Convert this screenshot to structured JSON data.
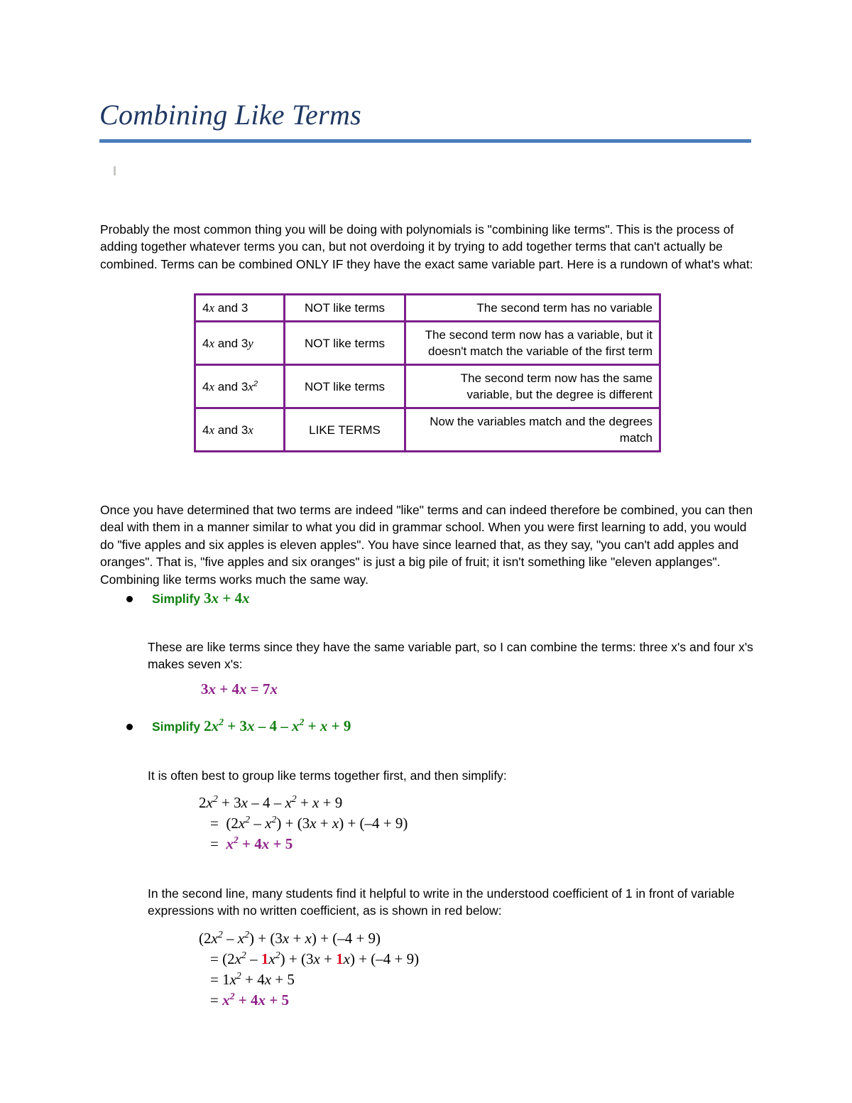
{
  "document": {
    "title": "Combining Like Terms",
    "title_color": "#1F3864",
    "rule_color": "#4A7EBB"
  },
  "intro": {
    "paragraph": "Probably the most common thing you will be doing with polynomials is \"combining like terms\". This is the process of adding together whatever terms you can, but not overdoing it by trying to add together terms that can't actually be combined. Terms can be combined ONLY IF they have the exact same variable part. Here is a rundown of what's what:"
  },
  "table": {
    "border_color": "#7D1F8C",
    "rows": [
      {
        "expr_prefix": "4",
        "expr_var": "x",
        "expr_mid": " and 3",
        "expr_second": "",
        "expr_second_exp": "",
        "expression_plain": "4x and 3",
        "verdict": "NOT like terms",
        "reason": "The second term has no variable"
      },
      {
        "expression_plain": "4x and 3y",
        "verdict": "NOT like terms",
        "reason": "The second term now has a variable, but it doesn't match the variable of the first term"
      },
      {
        "expression_plain": "4x and 3x2",
        "verdict": "NOT like terms",
        "reason": "The second term now has the same variable, but the degree is different"
      },
      {
        "expression_plain": "4x and 3x",
        "verdict": "LIKE TERMS",
        "reason": "Now the variables match and the degrees match"
      }
    ]
  },
  "apples": {
    "paragraph": "Once you have determined that two terms are indeed \"like\" terms and can indeed therefore be combined, you can then deal with them in a manner similar to what you did in grammar school. When you were first learning to add, you would do \"five apples and six apples is eleven apples\". You have since learned that, as they say, \"you can't add apples and oranges\". That is, \"five apples and six oranges\" is just a big pile of fruit; it isn't something like \"eleven applanges\". Combining like terms works much the same way."
  },
  "examples": [
    {
      "label": "Simplify",
      "problem_plain": "3x + 4x",
      "explanation": "These are like terms since they have the same variable part, so I can combine the terms: three x's and four x's makes seven x's:",
      "answer_plain": "3x + 4x = 7x"
    },
    {
      "label": "Simplify",
      "problem_plain": "2x2 + 3x – 4 – x2 + x + 9",
      "explanation": "It is often best to group like terms together first, and then simplify:",
      "work_lines_plain": [
        "2x2 + 3x – 4 – x2 + x + 9",
        "= (2x2 – x2) + (3x + x) + (–4 + 9)",
        "= x2 + 4x + 5"
      ],
      "note": "In the second line, many students find it helpful to write in the understood coefficient of 1 in front of variable expressions with no written coefficient, as is shown in red below:",
      "work_lines_2_plain": [
        "(2x2 – x2) + (3x + x) + (–4 + 9)",
        "= (2x2 – 1x2) + (3x + 1x) + (–4 + 9)",
        "= 1x2 + 4x + 5",
        "= x2 + 4x + 5"
      ]
    }
  ],
  "colors": {
    "green_heading": "#128012",
    "purple_answer": "#8E2188",
    "red_coefficient": "#DD0A20",
    "table_border": "#7D1F8C",
    "title": "#1F3864",
    "rule": "#4A7EBB"
  }
}
